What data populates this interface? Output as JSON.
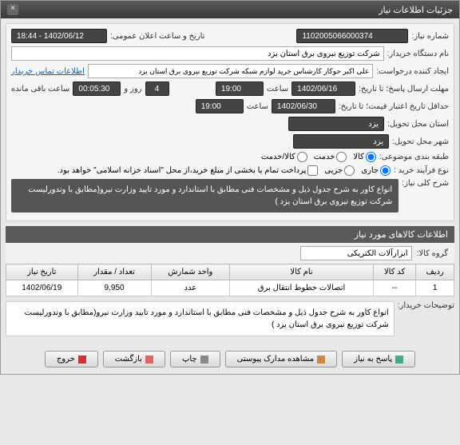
{
  "header": {
    "title": "جزئیات اطلاعات نیاز"
  },
  "form": {
    "need_no_label": "شماره نیاز:",
    "need_no": "1102005066000374",
    "ann_datetime_label": "تاریخ و ساعت اعلان عمومی:",
    "ann_datetime": "1402/06/12 - 18:44",
    "org_label": "نام دستگاه خریدار:",
    "org": "شرکت توزیع نیروی برق استان یزد",
    "creator_label": "ایجاد کننده درخواست:",
    "creator": "علی اکبر حوکار  کارشناس خرید لوازم شبکه  شرکت توزیع نیروی برق استان یزد",
    "contact_link": "اطلاعات تماس خریدار",
    "reply_deadline_label": "مهلت ارسال پاسخ؛ تا تاریخ:",
    "reply_date": "1402/06/16",
    "time_label": "ساعت",
    "reply_time": "19:00",
    "day_and_label": "روز و",
    "days": "4",
    "remain_time": "00:05:30",
    "remain_label": "ساعت باقی مانده",
    "valid_label": "حداقل تاریخ اعتبار قیمت؛ تا تاریخ:",
    "valid_date": "1402/06/30",
    "valid_time": "19:00",
    "province_label": "استان محل تحویل:",
    "province": "یزد",
    "city_label": "شهر محل تحویل:",
    "city": "یزد",
    "category_label": "طبقه بندی موضوعی:",
    "cat_goods": "کالا",
    "cat_service": "خدمت",
    "cat_goods_service": "کالا/خدمت",
    "process_label": "نوع فرآیند خرید :",
    "proc_current": "جاری",
    "proc_partial": "جزیی",
    "proc_note": "پرداخت تمام یا بخشی از مبلغ خرید،از محل \"اسناد خزانه اسلامی\" خواهد بود.",
    "desc_label": "شرح کلی نیاز:",
    "desc": "انواع کاور  به شرح جدول ذیل و مشخصات فنی مطابق با استاندارد و مورد تایید وزارت نیرو(مطابق با وندورلیست شرکت توزیع نیروی برق استان یزد )"
  },
  "items_section": {
    "title": "اطلاعات کالاهای مورد نیاز",
    "group_label": "گروه کالا:",
    "group": "ابزارآلات الکتریکی",
    "cols": {
      "row": "ردیف",
      "code": "کد کالا",
      "name": "نام کالا",
      "unit": "واحد شمارش",
      "qty": "تعداد / مقدار",
      "date": "تاریخ نیاز"
    },
    "rows": [
      {
        "row": "1",
        "code": "--",
        "name": "اتصالات خطوط انتقال برق",
        "unit": "عدد",
        "qty": "9,950",
        "date": "1402/06/19"
      }
    ],
    "note_label": "توضیحات خریدار:",
    "note": "انواع کاور  به شرح جدول ذیل و مشخصات فنی مطابق با استاندارد و مورد تایید وزارت نیرو(مطابق با وندورلیست شرکت توزیع نیروی برق استان یزد )"
  },
  "buttons": {
    "reply": "پاسخ به نیاز",
    "attachments": "مشاهده مدارک پیوستی",
    "print": "چاپ",
    "back": "بازگشت",
    "exit": "خروج"
  }
}
